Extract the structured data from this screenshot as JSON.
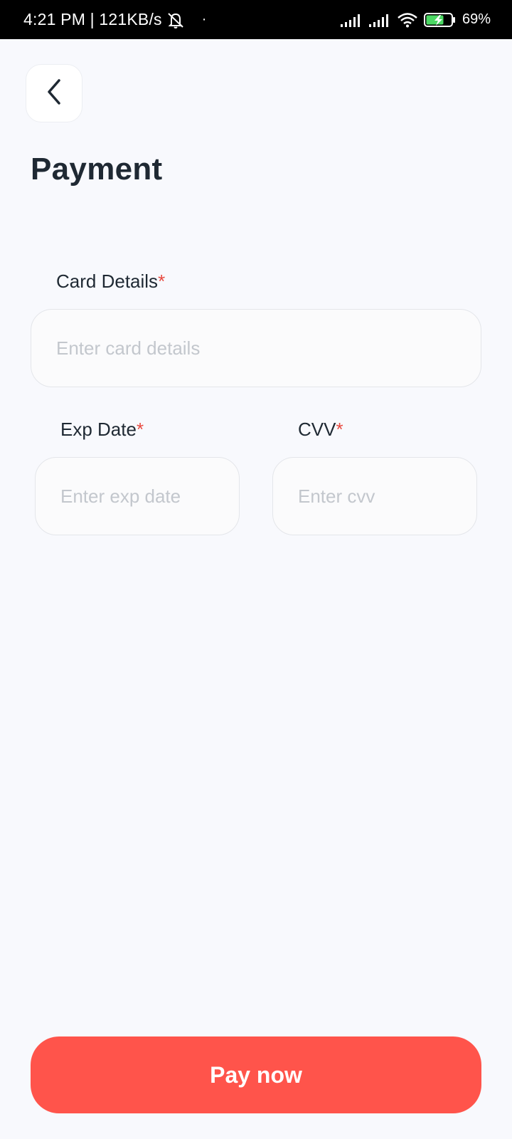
{
  "status_bar": {
    "time_and_speed": "4:21 PM | 121KB/s",
    "dot": "·",
    "battery": "69%"
  },
  "header": {
    "title": "Payment"
  },
  "form": {
    "card_details": {
      "label": "Card Details",
      "required_mark": "*",
      "placeholder": "Enter card details",
      "value": ""
    },
    "exp_date": {
      "label": "Exp Date",
      "required_mark": "*",
      "placeholder": "Enter exp date",
      "value": ""
    },
    "cvv": {
      "label": "CVV",
      "required_mark": "*",
      "placeholder": "Enter cvv",
      "value": ""
    }
  },
  "actions": {
    "pay_label": "Pay now"
  },
  "colors": {
    "accent": "#ff544b",
    "required": "#e84a40",
    "background": "#f8f9fd"
  }
}
